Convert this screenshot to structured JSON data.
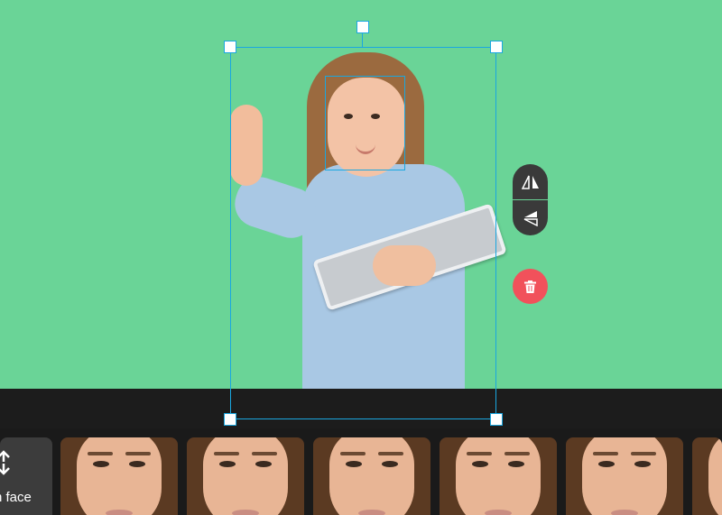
{
  "colors": {
    "canvas_bg": "#6ad497",
    "selection": "#1aa7e0",
    "delete": "#f1515b",
    "toolbar": "#1c1c1c"
  },
  "controls": {
    "flip_horizontal_icon": "flip-horizontal-icon",
    "flip_vertical_icon": "flip-vertical-icon",
    "delete_icon": "trash-icon"
  },
  "face_strip": {
    "swap_tile_icon": "swap-arrows-icon",
    "swap_tile_label": "n face",
    "face_count": 6
  }
}
